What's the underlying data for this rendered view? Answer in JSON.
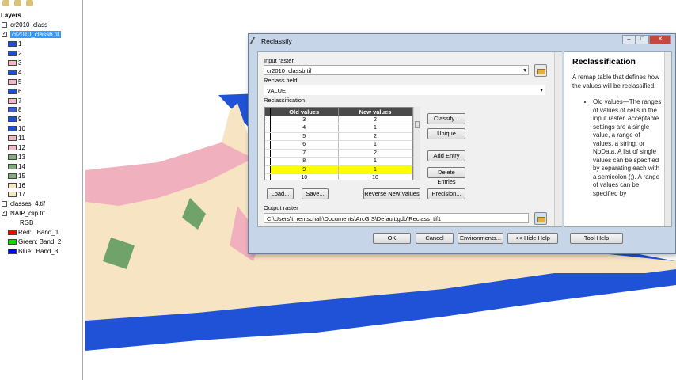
{
  "toc": {
    "title": "Layers",
    "layers": [
      {
        "name": "cr2010_class",
        "checked": false
      },
      {
        "name": "cr2010_classb.tif",
        "checked": true,
        "selected": true,
        "classes": [
          {
            "label": "1",
            "color": "#1f4fd8"
          },
          {
            "label": "2",
            "color": "#1f4fd8"
          },
          {
            "label": "3",
            "color": "#f4b8c2"
          },
          {
            "label": "4",
            "color": "#1f4fd8"
          },
          {
            "label": "5",
            "color": "#f4b8c2"
          },
          {
            "label": "6",
            "color": "#1f4fd8"
          },
          {
            "label": "7",
            "color": "#f4b8c2"
          },
          {
            "label": "8",
            "color": "#3a5fd0"
          },
          {
            "label": "9",
            "color": "#1f4fd8"
          },
          {
            "label": "10",
            "color": "#1f4fd8"
          },
          {
            "label": "11",
            "color": "#f4b8c2"
          },
          {
            "label": "12",
            "color": "#f4b8c2"
          },
          {
            "label": "13",
            "color": "#7fae7a"
          },
          {
            "label": "14",
            "color": "#7fae7a"
          },
          {
            "label": "15",
            "color": "#7fae7a"
          },
          {
            "label": "16",
            "color": "#f7e6c4"
          },
          {
            "label": "17",
            "color": "#f7e6c4"
          }
        ]
      },
      {
        "name": "classes_4.tif",
        "checked": false
      },
      {
        "name": "NAIP_clip.tif",
        "checked": true
      }
    ],
    "rgb": {
      "label": "RGB",
      "bands": [
        {
          "label": "Red:   Band_1",
          "color": "#ff0000"
        },
        {
          "label": "Green: Band_2",
          "color": "#00e000"
        },
        {
          "label": "Blue:  Band_3",
          "color": "#0000ff"
        }
      ]
    }
  },
  "dialog": {
    "title": "Reclassify",
    "input_raster_label": "Input raster",
    "input_raster": "cr2010_classb.tif",
    "reclass_field_label": "Reclass field",
    "reclass_field": "VALUE",
    "reclassification_label": "Reclassification",
    "columns": [
      "Old values",
      "New values"
    ],
    "rows": [
      [
        "3",
        "2"
      ],
      [
        "4",
        "1"
      ],
      [
        "5",
        "2"
      ],
      [
        "6",
        "1"
      ],
      [
        "7",
        "2"
      ],
      [
        "8",
        "1"
      ],
      [
        "9",
        "1"
      ],
      [
        "10",
        "10"
      ]
    ],
    "buttons": {
      "classify": "Classify...",
      "unique": "Unique",
      "add_entry": "Add Entry",
      "delete_entries": "Delete Entries",
      "load": "Load...",
      "save": "Save...",
      "reverse": "Reverse New Values",
      "precision": "Precision...",
      "ok": "OK",
      "cancel": "Cancel",
      "environments": "Environments...",
      "hide_help": "<< Hide Help",
      "tool_help": "Tool Help"
    },
    "output_raster_label": "Output raster",
    "output_raster": "C:\\Users\\t_rentschalr\\Documents\\ArcGIS\\Default.gdb\\Reclass_tif1"
  },
  "help": {
    "title": "Reclassification",
    "intro": "A remap table that defines how the values will be reclassified.",
    "bullet": "Old values—The ranges of values of cells in the input raster. Acceptable settings are a single value, a range of values, a string, or NoData. A list of single values can be specified by separating each with a semicolon (;). A range of values can be specified by"
  }
}
